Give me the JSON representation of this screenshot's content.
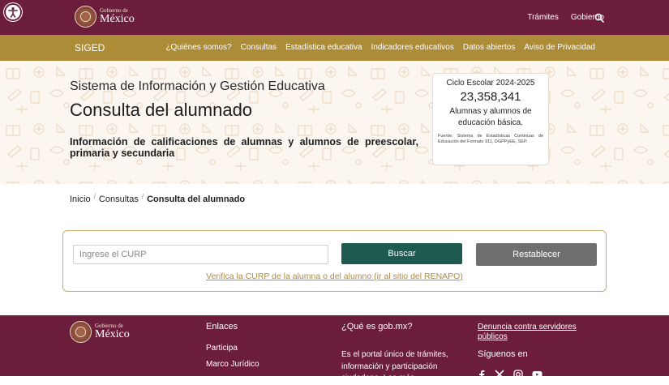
{
  "topbar": {
    "logo_small": "Gobierno de",
    "logo_big": "México",
    "nav": [
      "Trámites",
      "Gobierno"
    ],
    "search_icon": "search-icon",
    "accessibility_icon": "accessibility-icon"
  },
  "subbar": {
    "brand": "SIGED",
    "nav": [
      "¿Quiénes somos?",
      "Consultas",
      "Estadística educativa",
      "Indicadores educativos",
      "Datos abiertos",
      "Aviso de Privacidad"
    ]
  },
  "hero": {
    "subtitle": "Sistema de Información y Gestión Educativa",
    "title": "Consulta del alumnado",
    "description": "Información de calificaciones de alumnas y alumnos de preescolar, primaria y secundaria"
  },
  "stats": {
    "cycle": "Ciclo Escolar 2024-2025",
    "value": "23,358,341",
    "label": "Alumnas y alumnos de educación básica.",
    "source": "Fuente: Sistema de Estadísticas Continuas de Educación del Formato 911, DGPPyEE, SEP."
  },
  "breadcrumb": {
    "items": [
      "Inicio",
      "Consultas"
    ],
    "current": "Consulta del alumnado"
  },
  "search": {
    "placeholder": "Ingrese el CURP",
    "value": "",
    "search_label": "Buscar",
    "reset_label": "Restablecer",
    "renapo_link": "Verifica la CURP de la alumna o del alumno (ir al sitio del RENAPO)"
  },
  "footer": {
    "logo_small": "Gobierno de",
    "logo_big": "México",
    "links_title": "Enlaces",
    "links": [
      "Participa",
      "Marco Jurídico"
    ],
    "gob_title": "¿Qué es gob.mx?",
    "gob_text": "Es el portal único de trámites, información y participación ciudadana. Lee más",
    "denuncia": "Denuncia contra servidores públicos",
    "follow_title": "Síguenos en",
    "social_icons": [
      "facebook-icon",
      "x-icon",
      "instagram-icon",
      "youtube-icon"
    ]
  },
  "colors": {
    "guinda": "#6b1d3b",
    "gold": "#ad8c38",
    "green": "#1e5b4f",
    "gray_button": "#6f6f6f",
    "link_gold": "#b08a3e"
  }
}
